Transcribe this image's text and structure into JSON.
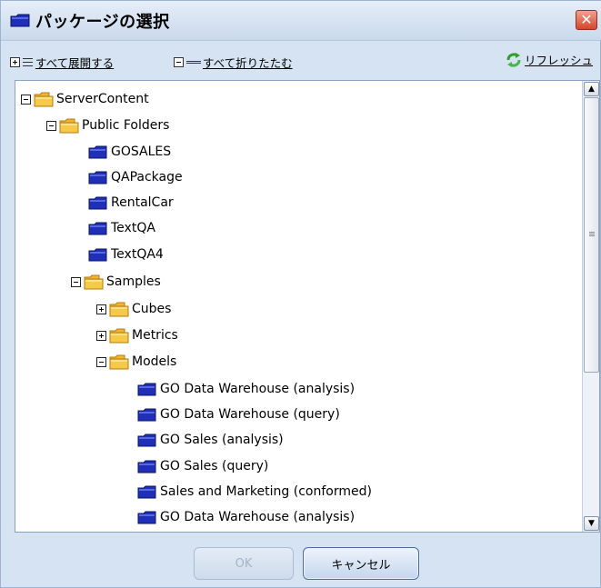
{
  "dialog": {
    "title": "パッケージの選択",
    "close_label": "✕"
  },
  "toolbar": {
    "expand_all": "すべて展開する",
    "collapse_all": "すべて折りたたむ",
    "refresh": "リフレッシュ"
  },
  "tree": {
    "server_content": "ServerContent",
    "public_folders": "Public Folders",
    "gosales": "GOSALES",
    "qapackage": "QAPackage",
    "rentalcar": "RentalCar",
    "textqa": "TextQA",
    "textqa4": "TextQA4",
    "samples": "Samples",
    "cubes": "Cubes",
    "metrics": "Metrics",
    "models": "Models",
    "model_items": [
      "GO Data Warehouse (analysis)",
      "GO Data Warehouse (query)",
      "GO Sales (analysis)",
      "GO Sales (query)",
      "Sales and Marketing (conformed)",
      "GO Data Warehouse (analysis)"
    ]
  },
  "buttons": {
    "ok": "OK",
    "cancel": "キャンセル"
  },
  "icons": {
    "folder_open": "folder-open-icon",
    "package": "package-icon",
    "refresh": "refresh-icon"
  },
  "colors": {
    "folder_yellow": "#f7c948",
    "package_blue": "#1f2fb8",
    "close_red": "#d6452c"
  }
}
